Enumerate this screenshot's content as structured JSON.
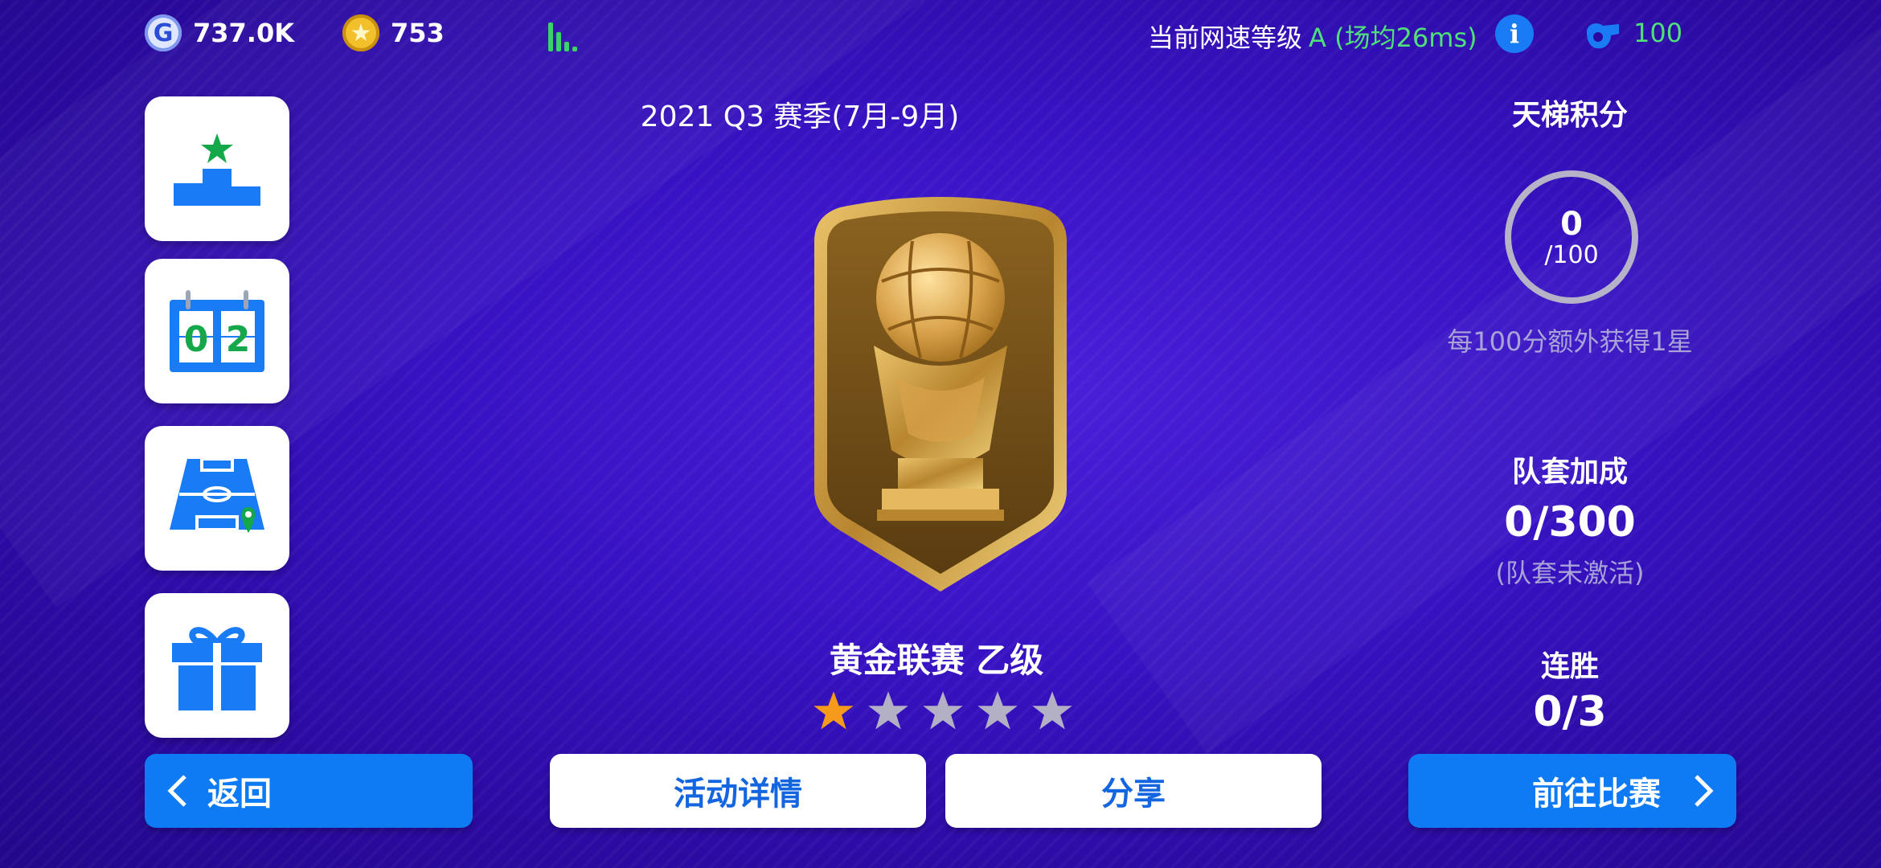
{
  "topbar": {
    "gp_icon": "G",
    "gp_value": "737.0K",
    "coin_value": "753",
    "network_label": "当前网速等级",
    "network_grade": "A (场均26ms)",
    "info_icon": "i",
    "energy_value": "100"
  },
  "left_menu": [
    "podium-icon",
    "scoreboard-icon",
    "pitch-location-icon",
    "gift-icon"
  ],
  "scoreboard": {
    "left_digit": "0",
    "right_digit": "2"
  },
  "season_label": "2021 Q3 赛季(7月-9月)",
  "league": {
    "name": "黄金联赛 乙级",
    "stars_filled": 1,
    "stars_total": 5
  },
  "ladder": {
    "title": "天梯积分",
    "value": "0",
    "denominator": "/100",
    "note": "每100分额外获得1星"
  },
  "kit_bonus": {
    "title": "队套加成",
    "value": "0/300",
    "note": "(队套未激活)"
  },
  "win_streak": {
    "title": "连胜",
    "value": "0/3"
  },
  "buttons": {
    "back": "返回",
    "details": "活动详情",
    "share": "分享",
    "go_match": "前往比赛"
  },
  "colors": {
    "accent_blue": "#0e7bf4",
    "green": "#4fe07a",
    "star_gold": "#f59a1b",
    "gold": "#c89a3a"
  }
}
